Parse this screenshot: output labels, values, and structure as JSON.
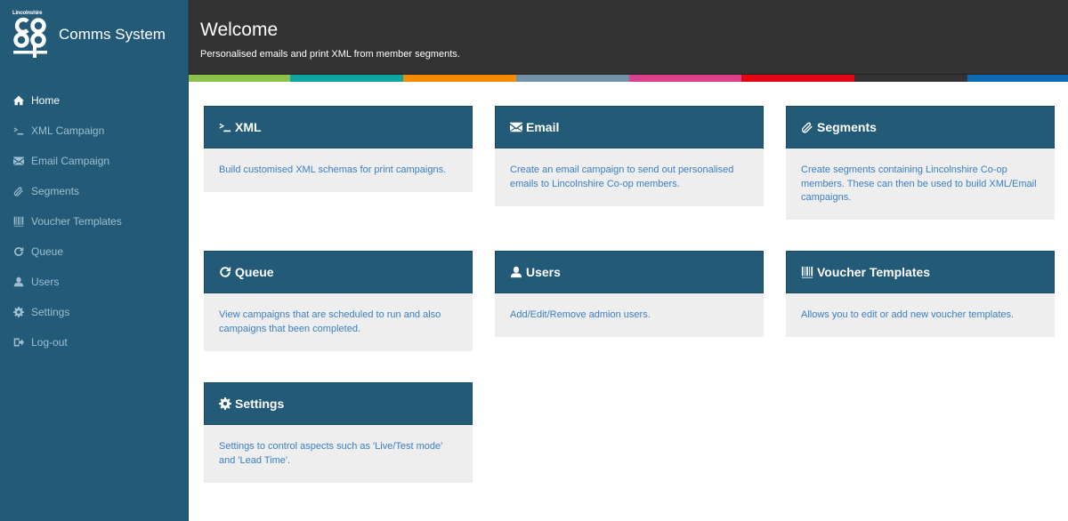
{
  "brand": {
    "logo_text_top": "Lincolnshire",
    "logo_name": "co-op-logo",
    "title": "Comms System",
    "sidebar_color": "#225a77"
  },
  "sidebar": {
    "items": [
      {
        "label": "Home",
        "icon": "home-icon",
        "active": true
      },
      {
        "label": "XML Campaign",
        "icon": "terminal-icon",
        "active": false
      },
      {
        "label": "Email Campaign",
        "icon": "envelope-icon",
        "active": false
      },
      {
        "label": "Segments",
        "icon": "paperclip-icon",
        "active": false
      },
      {
        "label": "Voucher Templates",
        "icon": "barcode-icon",
        "active": false
      },
      {
        "label": "Queue",
        "icon": "refresh-icon",
        "active": false
      },
      {
        "label": "Users",
        "icon": "user-icon",
        "active": false
      },
      {
        "label": "Settings",
        "icon": "gear-icon",
        "active": false
      },
      {
        "label": "Log-out",
        "icon": "logout-icon",
        "active": false
      }
    ]
  },
  "header": {
    "title": "Welcome",
    "subtitle": "Personalised emails and print XML from member segments.",
    "strip_colors": [
      "#8bc34a",
      "#0ea5a1",
      "#f28c00",
      "#7292a8",
      "#d9408e",
      "#e30613",
      "#333333",
      "#0a6ab5"
    ]
  },
  "cards": [
    {
      "title": "XML",
      "icon": "terminal-icon",
      "description": "Build customised XML schemas for print campaigns."
    },
    {
      "title": "Email",
      "icon": "envelope-icon",
      "description": "Create an email campaign to send out personalised emails to Lincolnshire Co-op members."
    },
    {
      "title": "Segments",
      "icon": "paperclip-icon",
      "description": "Create segments containing Lincolnshire Co-op members. These can then be used to build XML/Email campaigns."
    },
    {
      "title": "Queue",
      "icon": "refresh-icon",
      "description": "View campaigns that are scheduled to run and also campaigns that been completed."
    },
    {
      "title": "Users",
      "icon": "user-icon",
      "description": "Add/Edit/Remove admion users."
    },
    {
      "title": "Voucher Templates",
      "icon": "barcode-icon",
      "description": "Allows you to edit or add new voucher templates."
    },
    {
      "title": "Settings",
      "icon": "gear-icon",
      "description": "Settings to control aspects such as 'Live/Test mode' and 'Lead Time'."
    }
  ]
}
